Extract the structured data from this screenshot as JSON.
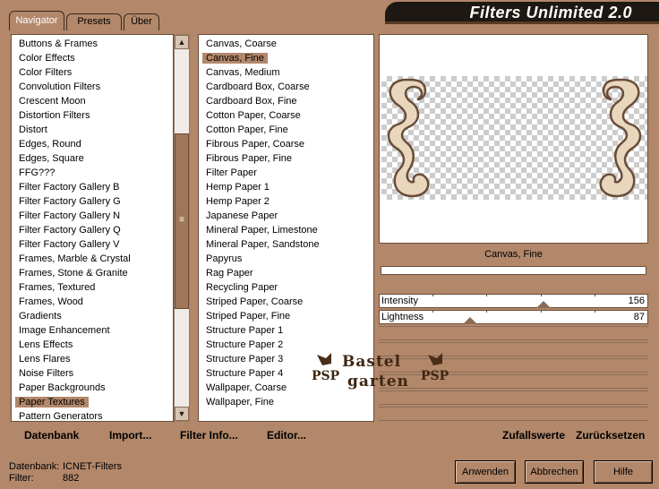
{
  "app": {
    "title": "Filters Unlimited 2.0"
  },
  "tabs": [
    {
      "label": "Navigator",
      "active": true
    },
    {
      "label": "Presets",
      "active": false
    },
    {
      "label": "Über",
      "active": false
    }
  ],
  "categories": [
    "Buttons & Frames",
    "Color Effects",
    "Color Filters",
    "Convolution Filters",
    "Crescent Moon",
    "Distortion Filters",
    "Distort",
    "Edges, Round",
    "Edges, Square",
    "FFG???",
    "Filter Factory Gallery B",
    "Filter Factory Gallery G",
    "Filter Factory Gallery N",
    "Filter Factory Gallery Q",
    "Filter Factory Gallery V",
    "Frames, Marble & Crystal",
    "Frames, Stone & Granite",
    "Frames, Textured",
    "Frames, Wood",
    "Gradients",
    "Image Enhancement",
    "Lens Effects",
    "Lens Flares",
    "Noise Filters",
    "Paper Backgrounds",
    "Paper Textures",
    "Pattern Generators"
  ],
  "selected_category_index": 25,
  "filters": [
    "Canvas, Coarse",
    "Canvas, Fine",
    "Canvas, Medium",
    "Cardboard Box, Coarse",
    "Cardboard Box, Fine",
    "Cotton Paper, Coarse",
    "Cotton Paper, Fine",
    "Fibrous Paper, Coarse",
    "Fibrous Paper, Fine",
    "Filter Paper",
    "Hemp Paper 1",
    "Hemp Paper 2",
    "Japanese Paper",
    "Mineral Paper, Limestone",
    "Mineral Paper, Sandstone",
    "Papyrus",
    "Rag Paper",
    "Recycling Paper",
    "Striped Paper, Coarse",
    "Striped Paper, Fine",
    "Structure Paper 1",
    "Structure Paper 2",
    "Structure Paper 3",
    "Structure Paper 4",
    "Wallpaper, Coarse",
    "Wallpaper, Fine"
  ],
  "selected_filter_index": 1,
  "preview": {
    "filter_name": "Canvas, Fine"
  },
  "sliders": [
    {
      "label": "Intensity",
      "value": "156",
      "fraction": 0.61
    },
    {
      "label": "Lightness",
      "value": "87",
      "fraction": 0.34
    }
  ],
  "links": {
    "datenbank": "Datenbank",
    "import": "Import...",
    "filter_info": "Filter Info...",
    "editor": "Editor...",
    "zufallswerte": "Zufallswerte",
    "zuruecksetzen": "Zurücksetzen"
  },
  "status": {
    "datenbank_label": "Datenbank:",
    "datenbank_value": "ICNET-Filters",
    "filter_label": "Filter:",
    "filter_value": "882"
  },
  "buttons": {
    "anwenden": "Anwenden",
    "abbrechen": "Abbrechen",
    "hilfe": "Hilfe"
  },
  "watermark": {
    "line1": "Bastel",
    "line2": "garten",
    "psp": "PSP"
  },
  "colors": {
    "background": "#b2876a",
    "banner": "#1e1812",
    "selection": "#b2876a"
  }
}
